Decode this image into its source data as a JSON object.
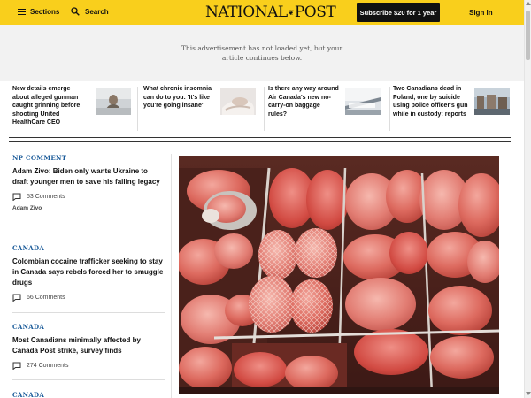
{
  "header": {
    "sections_label": "Sections",
    "search_label": "Search",
    "logo_left": "NATIONAL",
    "logo_right": "POST",
    "subscribe_label": "Subscribe $20 for 1 year",
    "signin_label": "Sign In",
    "accent_color": "#f9cf1c"
  },
  "ad": {
    "line1": "This advertisement has not loaded yet, but your",
    "line2": "article continues below."
  },
  "top_stories": [
    {
      "title": "New details emerge about alleged gunman caught grinning before shooting United HealthCare CEO"
    },
    {
      "title": "What chronic insomnia can do to you: 'It's like you're going insane'"
    },
    {
      "title": "Is there any way around Air Canada's new no-carry-on baggage rules?"
    },
    {
      "title": "Two Canadians dead in Poland, one by suicide using police officer's gun while in custody: reports"
    }
  ],
  "articles": [
    {
      "category": "NP COMMENT",
      "headline": "Adam Zivo: Biden only wants Ukraine to draft younger men to save his failing legacy",
      "comments": "53 Comments",
      "author": "Adam Zivo"
    },
    {
      "category": "CANADA",
      "headline": "Colombian cocaine trafficker seeking to stay in Canada says rebels forced her to smuggle drugs",
      "comments": "66 Comments"
    },
    {
      "category": "CANADA",
      "headline": "Most Canadians minimally affected by Canada Post strike, survey finds",
      "comments": "274 Comments"
    },
    {
      "category": "CANADA"
    }
  ],
  "colors": {
    "category_blue": "#1c5c9a",
    "ad_background": "#f2f2f2"
  }
}
